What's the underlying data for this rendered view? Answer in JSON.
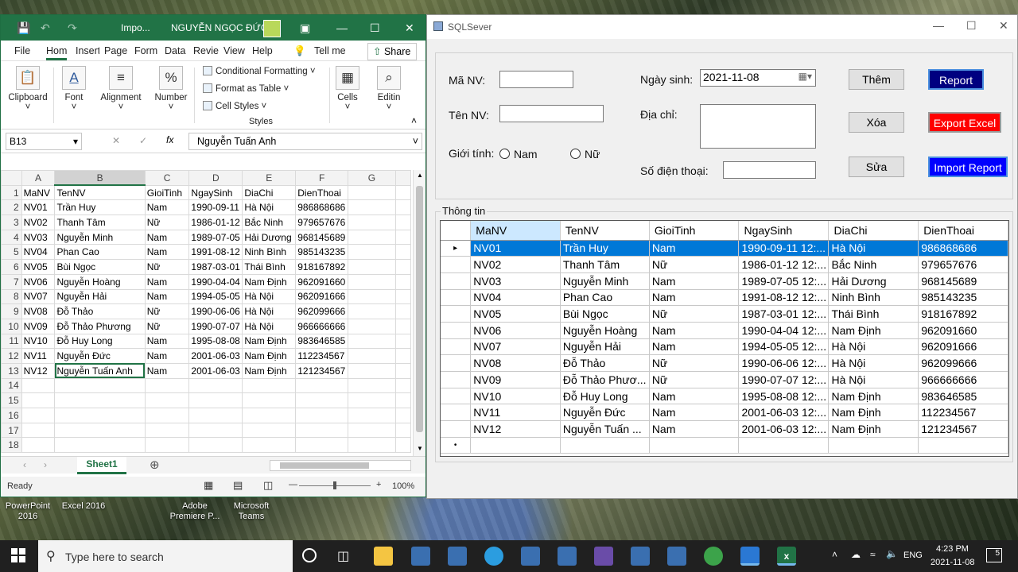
{
  "desktop": {
    "icons": [
      {
        "label_l1": "PowerPoint",
        "label_l2": "2016"
      },
      {
        "label_l1": "Excel 2016",
        "label_l2": ""
      },
      {
        "label_l1": "Adobe",
        "label_l2": "Premiere P..."
      },
      {
        "label_l1": "Microsoft",
        "label_l2": "Teams"
      }
    ]
  },
  "excel": {
    "title": "Impo...",
    "user": "NGUYỄN NGỌC ĐỨC",
    "tabs": [
      "File",
      "Hom",
      "Insert",
      "Page",
      "Form",
      "Data",
      "Revie",
      "View",
      "Help"
    ],
    "tell_me": "Tell me",
    "share": "Share",
    "ribbon": {
      "clipboard": "Clipboard",
      "font": "Font",
      "alignment": "Alignment",
      "number": "Number",
      "cond_format": "Conditional Formatting",
      "format_table": "Format as Table",
      "cell_styles": "Cell Styles",
      "styles": "Styles",
      "cells": "Cells",
      "editing": "Editin"
    },
    "namebox": "B13",
    "formula": "Nguyễn Tuấn Anh",
    "columns": [
      "A",
      "B",
      "C",
      "D",
      "E",
      "F",
      "G"
    ],
    "rows": [
      [
        "MaNV",
        "TenNV",
        "GioiTinh",
        "NgaySinh",
        "DiaChi",
        "DienThoai"
      ],
      [
        "NV01",
        "Trần Huy",
        "Nam",
        "1990-09-11",
        "Hà Nội",
        "986868686"
      ],
      [
        "NV02",
        "Thanh Tâm",
        "Nữ",
        "1986-01-12",
        "Bắc Ninh",
        "979657676"
      ],
      [
        "NV03",
        "Nguyễn Minh",
        "Nam",
        "1989-07-05",
        "Hải Dương",
        "968145689"
      ],
      [
        "NV04",
        "Phan Cao",
        "Nam",
        "1991-08-12",
        "Ninh Bình",
        "985143235"
      ],
      [
        "NV05",
        "Bùi Ngọc",
        "Nữ",
        "1987-03-01",
        "Thái Bình",
        "918167892"
      ],
      [
        "NV06",
        "Nguyễn Hoàng",
        "Nam",
        "1990-04-04",
        "Nam Định",
        "962091660"
      ],
      [
        "NV07",
        "Nguyễn Hải",
        "Nam",
        "1994-05-05",
        "Hà Nội",
        "962091666"
      ],
      [
        "NV08",
        "Đỗ Thảo",
        "Nữ",
        "1990-06-06",
        "Hà Nội",
        "962099666"
      ],
      [
        "NV09",
        "Đỗ Thảo Phương",
        "Nữ",
        "1990-07-07",
        "Hà Nội",
        "966666666"
      ],
      [
        "NV10",
        "Đỗ Huy Long",
        "Nam",
        "1995-08-08",
        "Nam Định",
        "983646585"
      ],
      [
        "NV11",
        "Nguyễn Đức",
        "Nam",
        "2001-06-03",
        "Nam Định",
        "112234567"
      ],
      [
        "NV12",
        "Nguyễn Tuấn Anh",
        "Nam",
        "2001-06-03",
        "Nam Định",
        "121234567"
      ]
    ],
    "row_numbers": [
      "1",
      "2",
      "3",
      "4",
      "5",
      "6",
      "7",
      "8",
      "9",
      "10",
      "11",
      "12",
      "13",
      "14",
      "15",
      "16",
      "17",
      "18"
    ],
    "sheet": "Sheet1",
    "status": "Ready",
    "zoom": "100%"
  },
  "form": {
    "title": "SQLSever",
    "labels": {
      "manv": "Mã NV:",
      "tennv": "Tên NV:",
      "gioitinh": "Giới tính:",
      "nam": "Nam",
      "nu": "Nữ",
      "ngaysinh": "Ngày sinh:",
      "diachi": "Địa chỉ:",
      "sdt": "Số điện thoại:",
      "group": "Thông tin"
    },
    "values": {
      "manv": "",
      "tennv": "",
      "ngaysinh": "2021-11-08",
      "diachi": "",
      "sdt": ""
    },
    "buttons": {
      "them": "Thêm",
      "xoa": "Xóa",
      "sua": "Sửa",
      "report": "Report",
      "export": "Export Excel",
      "import": "Import Report"
    },
    "colors": {
      "report_bg": "#000080",
      "export_bg": "#ff0000",
      "import_bg": "#0000ff",
      "selection": "#0078d7"
    },
    "grid_headers": [
      "MaNV",
      "TenNV",
      "GioiTinh",
      "NgaySinh",
      "DiaChi",
      "DienThoai"
    ],
    "grid_rows": [
      [
        "NV01",
        "Trần Huy",
        "Nam",
        "1990-09-11 12:...",
        "Hà Nội",
        "986868686"
      ],
      [
        "NV02",
        "Thanh Tâm",
        "Nữ",
        "1986-01-12 12:...",
        "Bắc Ninh",
        "979657676"
      ],
      [
        "NV03",
        "Nguyễn Minh",
        "Nam",
        "1989-07-05 12:...",
        "Hải Dương",
        "968145689"
      ],
      [
        "NV04",
        "Phan Cao",
        "Nam",
        "1991-08-12 12:...",
        "Ninh Bình",
        "985143235"
      ],
      [
        "NV05",
        "Bùi Ngọc",
        "Nữ",
        "1987-03-01 12:...",
        "Thái Bình",
        "918167892"
      ],
      [
        "NV06",
        "Nguyễn Hoàng",
        "Nam",
        "1990-04-04 12:...",
        "Nam Định",
        "962091660"
      ],
      [
        "NV07",
        "Nguyễn Hải",
        "Nam",
        "1994-05-05 12:...",
        "Hà Nội",
        "962091666"
      ],
      [
        "NV08",
        "Đỗ Thảo",
        "Nữ",
        "1990-06-06 12:...",
        "Hà Nội",
        "962099666"
      ],
      [
        "NV09",
        "Đỗ Thảo Phươ...",
        "Nữ",
        "1990-07-07 12:...",
        "Hà Nội",
        "966666666"
      ],
      [
        "NV10",
        "Đỗ Huy Long",
        "Nam",
        "1995-08-08 12:...",
        "Nam Định",
        "983646585"
      ],
      [
        "NV11",
        "Nguyễn Đức",
        "Nam",
        "2001-06-03 12:...",
        "Nam Định",
        "112234567"
      ],
      [
        "NV12",
        "Nguyễn Tuấn ...",
        "Nam",
        "2001-06-03 12:...",
        "Nam Định",
        "121234567"
      ]
    ],
    "selected_row": 0
  },
  "taskbar": {
    "search_placeholder": "Type here to search",
    "lang": "ENG",
    "time": "4:23 PM",
    "date": "2021-11-08",
    "notifications": "5"
  }
}
